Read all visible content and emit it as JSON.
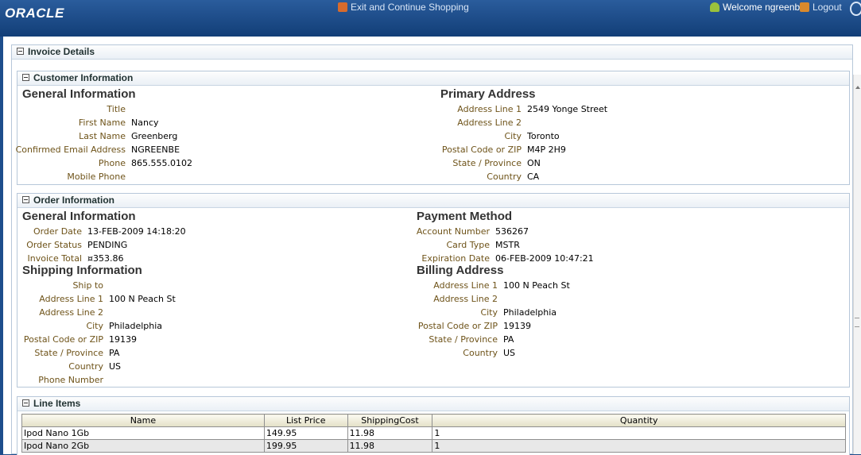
{
  "header": {
    "logo": "ORACLE",
    "exit_link": "Exit and Continue Shopping",
    "welcome": "Welcome ngreenbe",
    "logout": "Logout"
  },
  "invoice": {
    "title": "Invoice Details"
  },
  "customer": {
    "title": "Customer Information",
    "general": {
      "heading": "General Information",
      "fields": [
        {
          "label": "Title",
          "value": ""
        },
        {
          "label": "First Name",
          "value": "Nancy"
        },
        {
          "label": "Last Name",
          "value": "Greenberg"
        },
        {
          "label": "Confirmed Email Address",
          "value": "NGREENBE"
        },
        {
          "label": "Phone",
          "value": "865.555.0102"
        },
        {
          "label": "Mobile Phone",
          "value": ""
        }
      ]
    },
    "primary": {
      "heading": "Primary Address",
      "fields": [
        {
          "label": "Address Line 1",
          "value": "2549 Yonge Street"
        },
        {
          "label": "Address Line 2",
          "value": ""
        },
        {
          "label": "City",
          "value": "Toronto"
        },
        {
          "label": "Postal Code or ZIP",
          "value": "M4P 2H9"
        },
        {
          "label": "State / Province",
          "value": "ON"
        },
        {
          "label": "Country",
          "value": "CA"
        }
      ]
    }
  },
  "order": {
    "title": "Order Information",
    "general": {
      "heading": "General Information",
      "fields": [
        {
          "label": "Order Date",
          "value": "13-FEB-2009 14:18:20"
        },
        {
          "label": "Order Status",
          "value": "PENDING"
        },
        {
          "label": "Invoice Total",
          "value": "¤353.86"
        }
      ]
    },
    "payment": {
      "heading": "Payment Method",
      "fields": [
        {
          "label": "Account Number",
          "value": "536267"
        },
        {
          "label": "Card Type",
          "value": "MSTR"
        },
        {
          "label": "Expiration Date",
          "value": "06-FEB-2009 10:47:21"
        }
      ]
    },
    "shipping": {
      "heading": "Shipping Information",
      "fields": [
        {
          "label": "Ship to",
          "value": ""
        },
        {
          "label": "Address Line 1",
          "value": "100 N Peach St"
        },
        {
          "label": "Address Line 2",
          "value": ""
        },
        {
          "label": "City",
          "value": "Philadelphia"
        },
        {
          "label": "Postal Code or ZIP",
          "value": "19139"
        },
        {
          "label": "State / Province",
          "value": "PA"
        },
        {
          "label": "Country",
          "value": "US"
        },
        {
          "label": "Phone Number",
          "value": ""
        }
      ]
    },
    "billing": {
      "heading": "Billing Address",
      "fields": [
        {
          "label": "Address Line 1",
          "value": "100 N Peach St"
        },
        {
          "label": "Address Line 2",
          "value": ""
        },
        {
          "label": "City",
          "value": "Philadelphia"
        },
        {
          "label": "Postal Code or ZIP",
          "value": "19139"
        },
        {
          "label": "State / Province",
          "value": "PA"
        },
        {
          "label": "Country",
          "value": "US"
        }
      ]
    }
  },
  "line_items": {
    "title": "Line Items",
    "columns": [
      "Name",
      "List Price",
      "ShippingCost",
      "Quantity"
    ],
    "rows": [
      [
        "Ipod Nano 1Gb",
        "149.95",
        "11.98",
        "1"
      ],
      [
        "Ipod Nano 2Gb",
        "199.95",
        "11.98",
        "1"
      ]
    ]
  },
  "icons": {
    "toggle": "collapse-icon",
    "home": "home-icon",
    "user": "user-icon",
    "logout": "logout-icon"
  }
}
